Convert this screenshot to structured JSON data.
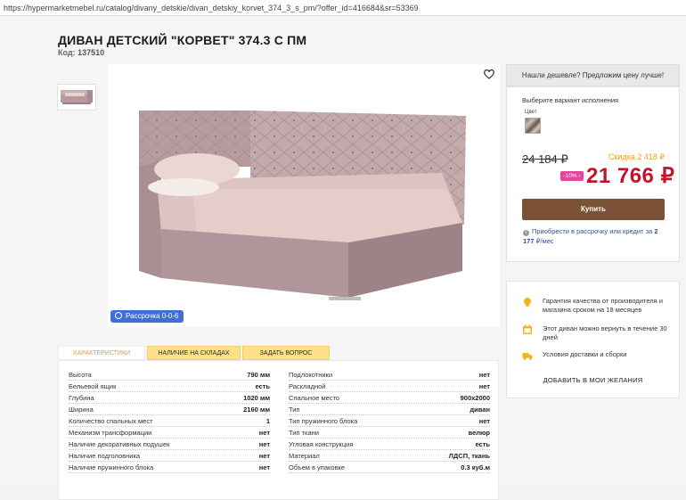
{
  "browser": {
    "url": "https://hypermarketmebel.ru/catalog/divany_detskie/divan_detskiy_korvet_374_3_s_pm/?offer_id=416684&sr=53369"
  },
  "product": {
    "title": "ДИВАН ДЕТСКИЙ \"КОРВЕТ\" 374.3 С ПМ",
    "code_label": "Код:",
    "code_value": "137510",
    "installment_badge": "Рассрочка 0-0-6"
  },
  "tabs": [
    {
      "label": "ХАРАКТЕРИСТИКИ",
      "active": true
    },
    {
      "label": "НАЛИЧИЕ НА СКЛАДАХ",
      "active": false
    },
    {
      "label": "ЗАДАТЬ ВОПРОС",
      "active": false
    }
  ],
  "specs_left": [
    {
      "k": "Высота",
      "v": "790 мм"
    },
    {
      "k": "Бельевой ящик",
      "v": "есть"
    },
    {
      "k": "Глубина",
      "v": "1020 мм"
    },
    {
      "k": "Ширина",
      "v": "2160 мм"
    },
    {
      "k": "Количество спальных мест",
      "v": "1"
    },
    {
      "k": "Механизм трансформации",
      "v": "нет"
    },
    {
      "k": "Наличие декоративных подушек",
      "v": "нет"
    },
    {
      "k": "Наличие подголовника",
      "v": "нет"
    },
    {
      "k": "Наличие пружинного блока",
      "v": "нет"
    }
  ],
  "specs_right": [
    {
      "k": "Подлокотники",
      "v": "нет"
    },
    {
      "k": "Раскладной",
      "v": "нет"
    },
    {
      "k": "Спальное место",
      "v": "900х2000"
    },
    {
      "k": "Тип",
      "v": "диван"
    },
    {
      "k": "Тип пружинного блока",
      "v": "нет"
    },
    {
      "k": "Тип ткани",
      "v": "велюр"
    },
    {
      "k": "Угловая конструкция",
      "v": "есть"
    },
    {
      "k": "Материал",
      "v": "ЛДСП, ткань"
    },
    {
      "k": "Объем в упаковке",
      "v": "0.3 куб.м"
    }
  ],
  "sidebar": {
    "cheaper": "Нашли дешевле? Предложим цену лучше!",
    "variant_label": "Выберите вариант исполнения",
    "color_label": "Цвет",
    "old_price": "24 184 ₽",
    "discount": "Скидка 2 418 ₽",
    "percent": "-10% ›",
    "price": "21 766 ₽",
    "buy": "Купить",
    "credit_prefix": "Приобрести в рассрочку или кредит за",
    "credit_amount": "2 177",
    "credit_suffix": "₽/мес",
    "info": [
      {
        "icon": "quality-badge-icon",
        "text": "Гарантия качества от производителя и магазина сроком на 18 месяцев"
      },
      {
        "icon": "return-calendar-icon",
        "text": "Этот диван можно вернуть в течение 30 дней"
      },
      {
        "icon": "delivery-truck-icon",
        "text": "Условия доставки и сборки"
      }
    ],
    "wishlist": "ДОБАВИТЬ В МОИ ЖЕЛАНИЯ"
  },
  "colors": {
    "price_red": "#c0152a",
    "buy_brown": "#7b5236",
    "tab_yellow": "#ffe08a",
    "discount_orange": "#f0a515",
    "badge_pink": "#e8449a",
    "installment_blue": "#3f6fd6"
  }
}
